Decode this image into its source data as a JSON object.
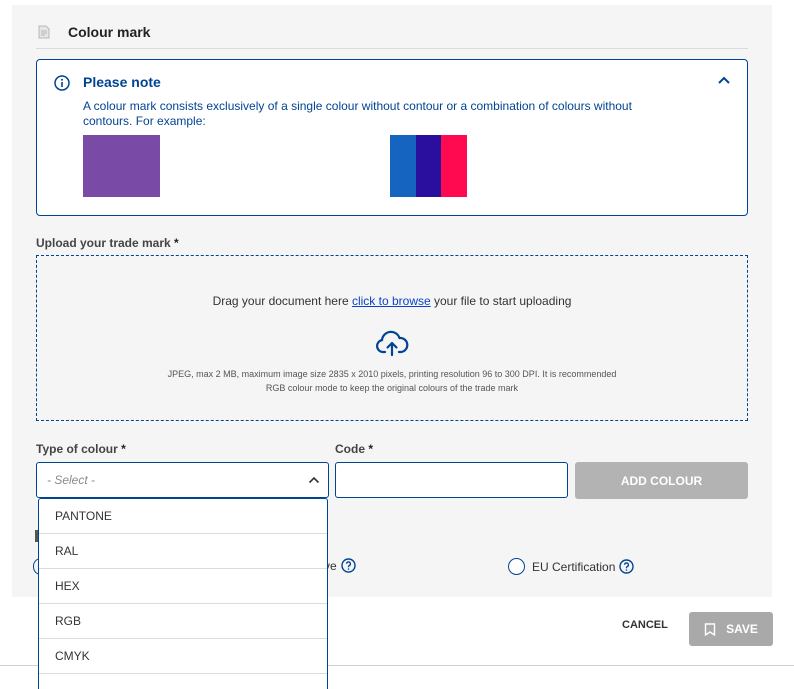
{
  "section": {
    "title": "Colour mark",
    "icon": "document-icon"
  },
  "note": {
    "title": "Please note",
    "text": "A colour mark consists exclusively of a single colour without contour or a combination of colours without contours. For example:",
    "icon": "info-icon",
    "collapse_icon": "chevron-up-icon",
    "single_colour": "#7a4ba6",
    "combo_colours": [
      "#1565c0",
      "#2a0f9e",
      "#ff0a50"
    ]
  },
  "upload": {
    "label": "Upload your trade mark",
    "required_mark": "*",
    "drag_before": "Drag your document here ",
    "browse_link": "click to browse",
    "drag_after": " your file to start uploading",
    "icon": "cloud-upload-icon",
    "hint_line1": "JPEG, max 2 MB, maximum image size 2835 x 2010 pixels, printing resolution 96 to 300 DPI. It is recommended",
    "hint_line2": "RGB colour mode to keep the original colours of the trade mark"
  },
  "colour_type": {
    "label": "Type of colour",
    "required_mark": "*",
    "placeholder": "- Select -",
    "options": [
      "PANTONE",
      "RAL",
      "HEX",
      "RGB",
      "CMYK"
    ]
  },
  "code": {
    "label": "Code",
    "required_mark": "*",
    "value": ""
  },
  "add_button": "ADD COLOUR",
  "radios": {
    "collective_partial": "llective",
    "eu_certification": "EU Certification"
  },
  "actions": {
    "cancel": "CANCEL",
    "save": "SAVE"
  },
  "colors": {
    "primary": "#004494",
    "disabled_button": "#b3b3b3",
    "panel_bg": "#f5f5f5"
  }
}
